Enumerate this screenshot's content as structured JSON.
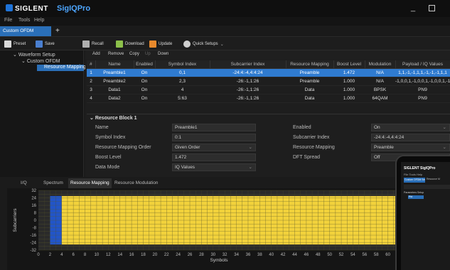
{
  "brand": "SIGLENT",
  "app_name": "SigIQPro",
  "window": {
    "minimize": "_",
    "maximize": ""
  },
  "menu": [
    "File",
    "Tools",
    "Help"
  ],
  "doc_tab": "Custom OFDM",
  "add_tab": "+",
  "toolbar": [
    {
      "label": "Preset",
      "icon": "preset-icon",
      "color": "#d9d9d9"
    },
    {
      "label": "Save",
      "icon": "save-icon",
      "color": "#4a7fd0"
    },
    {
      "label": "Recall",
      "icon": "recall-icon",
      "color": "#b0b0b0"
    },
    {
      "label": "Download",
      "icon": "download-icon",
      "color": "#8cc04a"
    },
    {
      "label": "Update",
      "icon": "update-icon",
      "color": "#e8892c"
    },
    {
      "label": "Quick Setups",
      "icon": "quick-setups-icon",
      "color": "#cfcfcf"
    }
  ],
  "tree": {
    "root": "Waveform Setup",
    "child": "Custom OFDM",
    "leaf": "Resource Mapping"
  },
  "segment_toolbar": [
    {
      "label": "Add",
      "enabled": true
    },
    {
      "label": "Remove",
      "enabled": true
    },
    {
      "label": "Copy",
      "enabled": true
    },
    {
      "label": "Up",
      "enabled": false
    },
    {
      "label": "Down",
      "enabled": true
    }
  ],
  "table": {
    "columns": [
      "#",
      "Name",
      "Enabled",
      "Symbol Index",
      "Subcarrier Index",
      "Resource Mapping",
      "Boost Level",
      "Modulation",
      "Payload / IQ Values"
    ],
    "rows": [
      [
        "1",
        "Preamble1",
        "On",
        "0,1",
        "-24:4:-4,4:4:24",
        "Preamble",
        "1.472",
        "N/A",
        "1,1,-1,-1,1,1,-1,-1,-1,1,1"
      ],
      [
        "2",
        "Preamble2",
        "On",
        "2,3",
        "-26:-1,1:26",
        "Preamble",
        "1.000",
        "N/A",
        "-1,0,0,1,-1,0,0,1,-1,0,0,1,-1"
      ],
      [
        "3",
        "Data1",
        "On",
        "4",
        "-26:-1,1:26",
        "Data",
        "1.000",
        "BPSK",
        "PN9"
      ],
      [
        "4",
        "Data2",
        "On",
        "5:63",
        "-26:-1,1:26",
        "Data",
        "1.000",
        "64QAM",
        "PN9"
      ]
    ],
    "selected_row": 0
  },
  "resource_block": {
    "title": "Resource Block 1",
    "left": [
      {
        "label": "Name",
        "value": "Preamble1",
        "dropdown": false
      },
      {
        "label": "Symbol Index",
        "value": "0:1",
        "dropdown": false
      },
      {
        "label": "Resource Mapping Order",
        "value": "Given Order",
        "dropdown": true
      },
      {
        "label": "Boost Level",
        "value": "1.472",
        "dropdown": false
      },
      {
        "label": "Data Mode",
        "value": "IQ Values",
        "dropdown": true
      }
    ],
    "right": [
      {
        "label": "Enabled",
        "value": "On",
        "dropdown": true
      },
      {
        "label": "Subcarrier Index",
        "value": "-24:4:-4,4:4:24",
        "dropdown": false
      },
      {
        "label": "Resource Mapping",
        "value": "Preamble",
        "dropdown": true
      },
      {
        "label": "DFT Spread",
        "value": "Off",
        "dropdown": true
      }
    ]
  },
  "bottom_tabs": [
    "I/Q",
    "Spectrum",
    "Resource Mapping",
    "Resource Modulation"
  ],
  "bottom_active": 2,
  "chart_data": {
    "type": "heatmap",
    "xlabel": "Symbols",
    "ylabel": "Subcarriers",
    "x_ticks": [
      0,
      2,
      4,
      6,
      8,
      10,
      12,
      14,
      16,
      18,
      20,
      22,
      24,
      26,
      28,
      30,
      32,
      34,
      36,
      38,
      40,
      42,
      44,
      46,
      48,
      50,
      52,
      54,
      56,
      58,
      60
    ],
    "y_ticks": [
      32,
      24,
      16,
      8,
      0,
      -8,
      -16,
      -24,
      -32
    ],
    "xlim": [
      0,
      62
    ],
    "ylim": [
      -32,
      32
    ],
    "regions": [
      {
        "name": "Preamble",
        "symbols": [
          2,
          4
        ],
        "subcarriers": [
          -26,
          26
        ],
        "color": "#2255c8"
      },
      {
        "name": "Data",
        "symbols": [
          4,
          62
        ],
        "subcarriers": [
          -26,
          26
        ],
        "color": "#f2d23c"
      },
      {
        "name": "Guard",
        "symbols": [
          0,
          2
        ],
        "subcarriers": [
          -32,
          32
        ],
        "color": "#d83a3a"
      }
    ]
  },
  "phone": {
    "logo": "SIGLENT SigIQPro",
    "menu": "File  Tools  Help",
    "tab": "Custom OFDM Setup",
    "tab2": "Resource M",
    "tree": "Parameters Setup",
    "leaf": "Pkt"
  }
}
